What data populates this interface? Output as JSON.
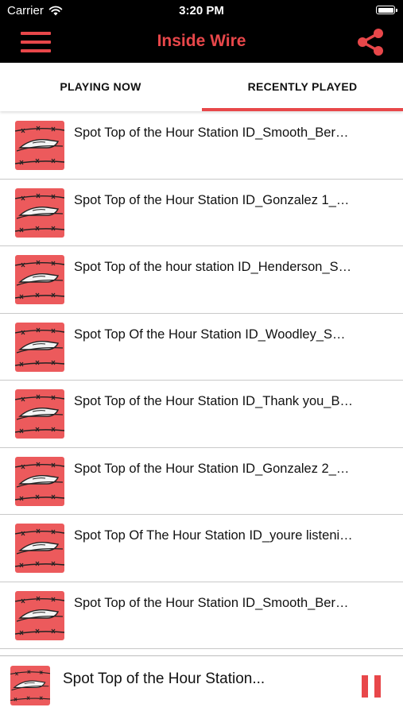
{
  "status_bar": {
    "carrier": "Carrier",
    "time": "3:20 PM",
    "icons": [
      "wifi-icon",
      "battery-icon"
    ]
  },
  "header": {
    "title": "Inside Wire",
    "menu_icon": "hamburger-menu-icon",
    "share_icon": "share-icon"
  },
  "tabs": [
    {
      "label": "PLAYING NOW",
      "selected": false
    },
    {
      "label": "RECENTLY PLAYED",
      "selected": true
    }
  ],
  "recently_played": [
    {
      "title": "Spot Top of the Hour Station ID_Smooth_Bernard Black",
      "title_visible": "Spot Top of the Hour Station ID_Smooth_Ber…"
    },
    {
      "title": "Spot Top of the Hour Station ID_Gonzalez 1",
      "title_visible": "Spot Top of the Hour Station ID_Gonzalez 1_…"
    },
    {
      "title": "Spot Top of the hour station ID_Henderson",
      "title_visible": "Spot Top of the hour station ID_Henderson_S…"
    },
    {
      "title": "Spot Top Of the Hour Station ID_Woodley",
      "title_visible": "Spot Top Of the Hour Station ID_Woodley_S…"
    },
    {
      "title": "Spot Top of the Hour Station ID_Thank you",
      "title_visible": "Spot Top of the Hour Station ID_Thank you_B…"
    },
    {
      "title": "Spot Top of the Hour Station ID_Gonzalez 2",
      "title_visible": "Spot Top of the Hour Station ID_Gonzalez 2_…"
    },
    {
      "title": "Spot Top Of The Hour Station ID_youre listening",
      "title_visible": "Spot Top Of The Hour Station ID_youre listeni…"
    },
    {
      "title": "Spot Top of the Hour Station ID_Smooth_Bernard Black",
      "title_visible": "Spot Top of the Hour Station ID_Smooth_Ber…"
    }
  ],
  "mini_player": {
    "title_visible": "Spot Top of the Hour Station...",
    "state": "playing",
    "control_icon": "pause-icon"
  },
  "colors": {
    "accent": "#e8474a",
    "header_bg": "#000000",
    "thumb_bg": "#ec5a5c",
    "divider": "#c9c9c9"
  }
}
